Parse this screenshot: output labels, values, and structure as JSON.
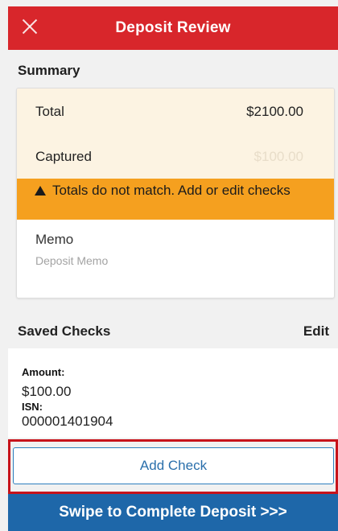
{
  "header": {
    "title": "Deposit Review",
    "close_icon": "close-icon"
  },
  "summary": {
    "title": "Summary",
    "total_label": "Total",
    "total_value": "$2100.00",
    "captured_label": "Captured",
    "captured_value": "$100.00",
    "warning": "Totals do not match. Add or edit checks",
    "warning_icon": "warning-icon",
    "memo_label": "Memo",
    "memo_placeholder": "Deposit Memo"
  },
  "saved_checks": {
    "title": "Saved Checks",
    "edit_label": "Edit",
    "items": [
      {
        "amount_label": "Amount:",
        "amount": "$100.00",
        "isn_label": "ISN:",
        "isn": "000001401904"
      }
    ]
  },
  "actions": {
    "add_check": "Add Check",
    "swipe_complete": "Swipe to Complete Deposit >>>"
  },
  "colors": {
    "header": "#d8262b",
    "warning": "#f5a01f",
    "summary_row": "#fcf3e2",
    "swipe_bar": "#1e67a9",
    "link": "#2a6fab",
    "highlight_border": "#c7131b"
  }
}
